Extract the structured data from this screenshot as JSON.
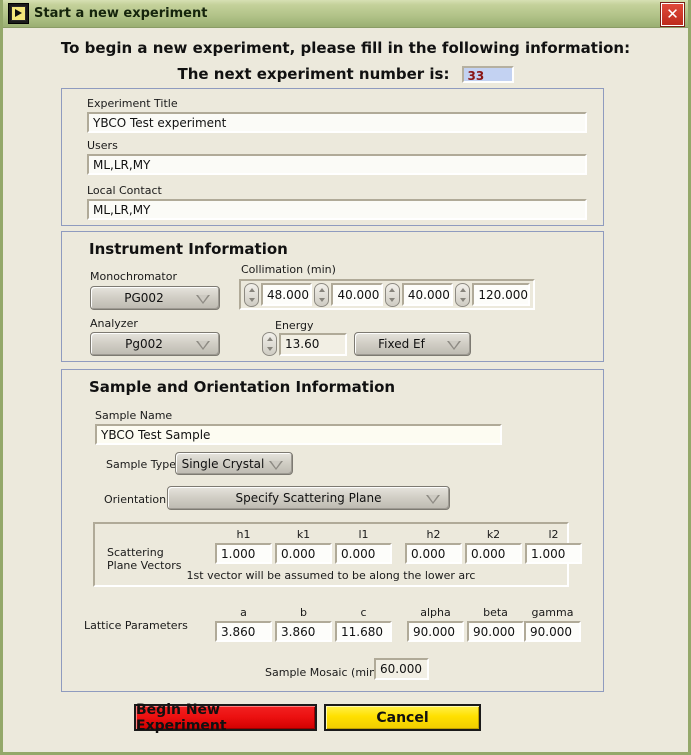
{
  "window": {
    "title": "Start a new experiment",
    "icon": "labview-vi-icon",
    "close_label": "✕",
    "accent_titlebar": "#b3c48a",
    "background": "#ece9dc"
  },
  "header": {
    "prompt": "To begin a new experiment, please fill in the following information:",
    "next_number_label": "The next experiment number is:",
    "next_number_value": "33",
    "next_number_bg": "#c3d2f2",
    "next_number_fg": "#8a1515"
  },
  "experiment_info": {
    "fields": [
      {
        "label": "Experiment Title",
        "value": "YBCO Test experiment"
      },
      {
        "label": "Users",
        "value": "ML,LR,MY"
      },
      {
        "label": "Local Contact",
        "value": "ML,LR,MY"
      }
    ]
  },
  "instrument": {
    "title": "Instrument Information",
    "monochromator": {
      "label": "Monochromator",
      "value": "PG002"
    },
    "analyzer": {
      "label": "Analyzer",
      "value": "Pg002"
    },
    "collimation": {
      "label": "Collimation (min)",
      "values": [
        "48.000",
        "40.000",
        "40.000",
        "120.000"
      ]
    },
    "energy": {
      "label": "Energy",
      "value": "13.60"
    },
    "fixed_mode": {
      "value": "Fixed Ef"
    }
  },
  "sample": {
    "title": "Sample and Orientation Information",
    "sample_name": {
      "label": "Sample Name",
      "value": "YBCO Test Sample"
    },
    "sample_type": {
      "label": "Sample Type",
      "value": "Single Crystal"
    },
    "orientation": {
      "label": "Orientation",
      "value": "Specify Scattering Plane"
    },
    "scattering": {
      "label_line1": "Scattering",
      "label_line2": "Plane Vectors",
      "headers": [
        "h1",
        "k1",
        "l1",
        "h2",
        "k2",
        "l2"
      ],
      "values": [
        "1.000",
        "0.000",
        "0.000",
        "0.000",
        "0.000",
        "1.000"
      ],
      "note": "1st vector will be assumed to be along the lower arc"
    },
    "lattice": {
      "label": "Lattice Parameters",
      "headers": [
        "a",
        "b",
        "c",
        "alpha",
        "beta",
        "gamma"
      ],
      "values": [
        "3.860",
        "3.860",
        "11.680",
        "90.000",
        "90.000",
        "90.000"
      ]
    },
    "mosaic": {
      "label": "Sample Mosaic (min)",
      "value": "60.000"
    }
  },
  "actions": {
    "begin": {
      "label": "Begin New Experiment",
      "color": "#ec1111"
    },
    "cancel": {
      "label": "Cancel",
      "color": "#ffe000"
    }
  }
}
